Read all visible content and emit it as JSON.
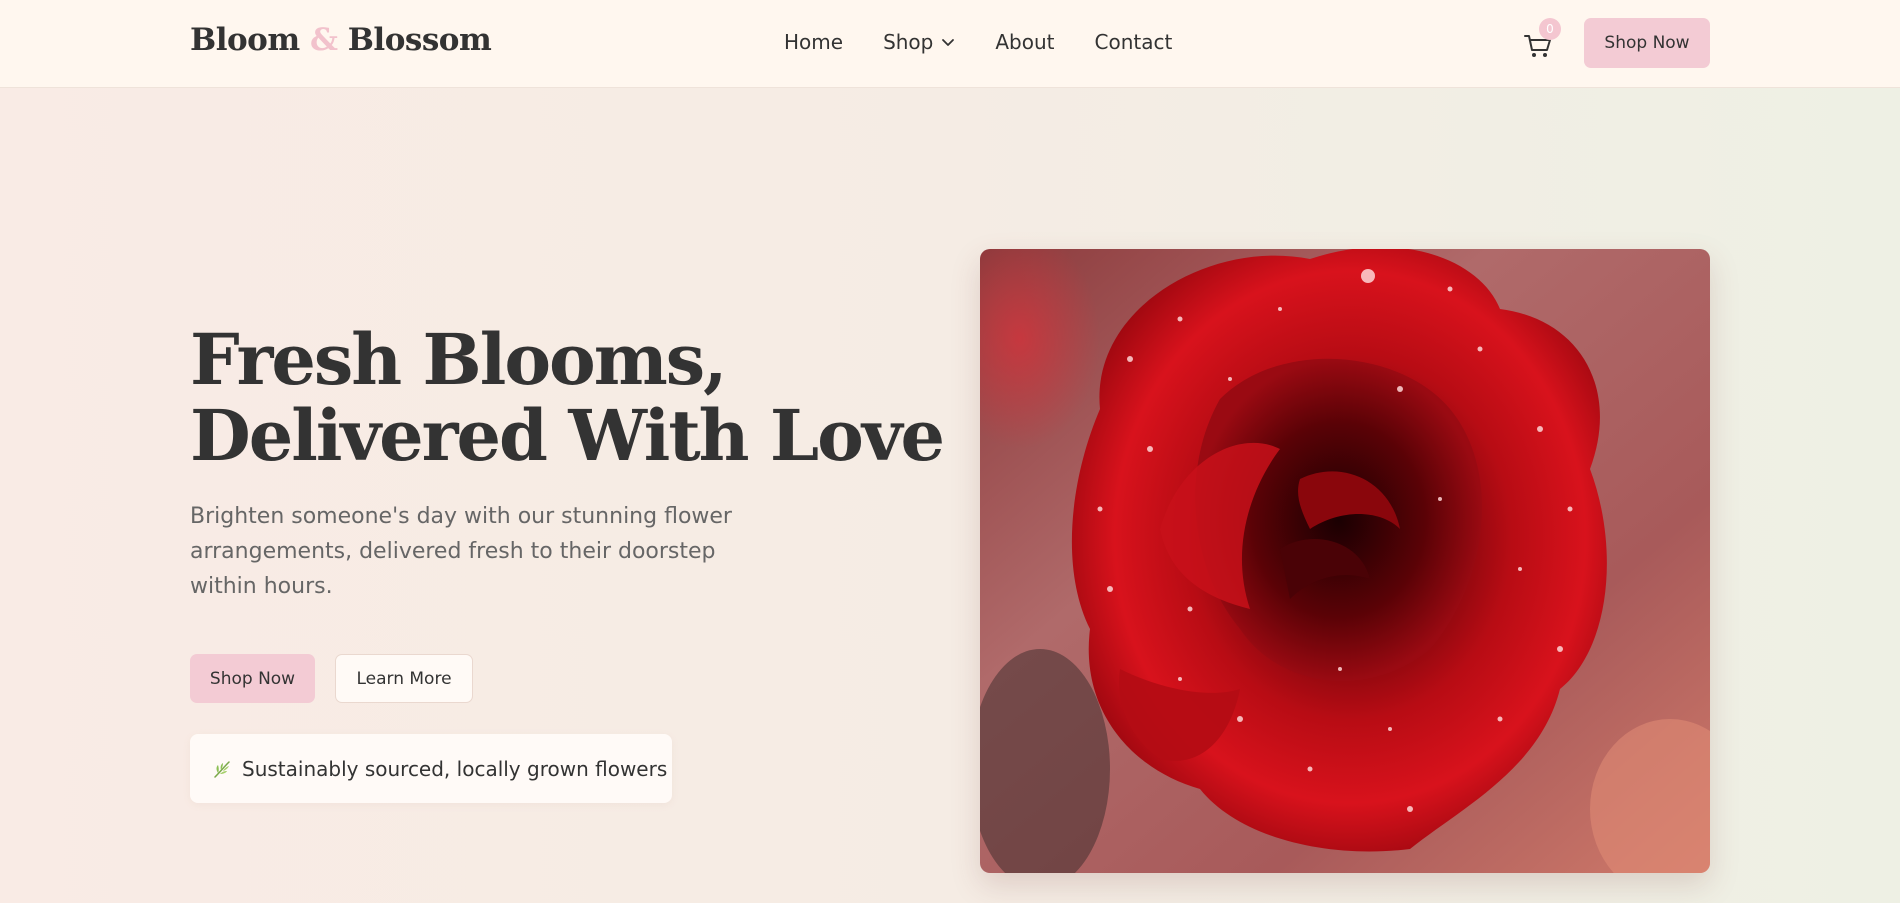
{
  "brand": {
    "name_part1": "Bloom",
    "ampersand": "&",
    "name_part2": "Blossom"
  },
  "nav": {
    "items": [
      {
        "label": "Home"
      },
      {
        "label": "Shop"
      },
      {
        "label": "About"
      },
      {
        "label": "Contact"
      }
    ],
    "cart_count": "0",
    "cta_label": "Shop Now"
  },
  "hero": {
    "title_line1": "Fresh Blooms,",
    "title_line2": "Delivered With Love",
    "subtitle": "Brighten someone's day with our stunning flower arrangements, delivered fresh to their doorstep within hours.",
    "primary_cta": "Shop Now",
    "secondary_cta": "Learn More",
    "badge_icon": "leaf-icon",
    "badge_text": "Sustainably sourced, locally grown flowers",
    "image_subject": "red rose with water droplets"
  },
  "colors": {
    "accent_pink": "#f3cbd4",
    "nav_bg": "#fff7ef",
    "text_dark": "#333333",
    "text_muted": "#666666",
    "rose_red": "#c8101a"
  }
}
